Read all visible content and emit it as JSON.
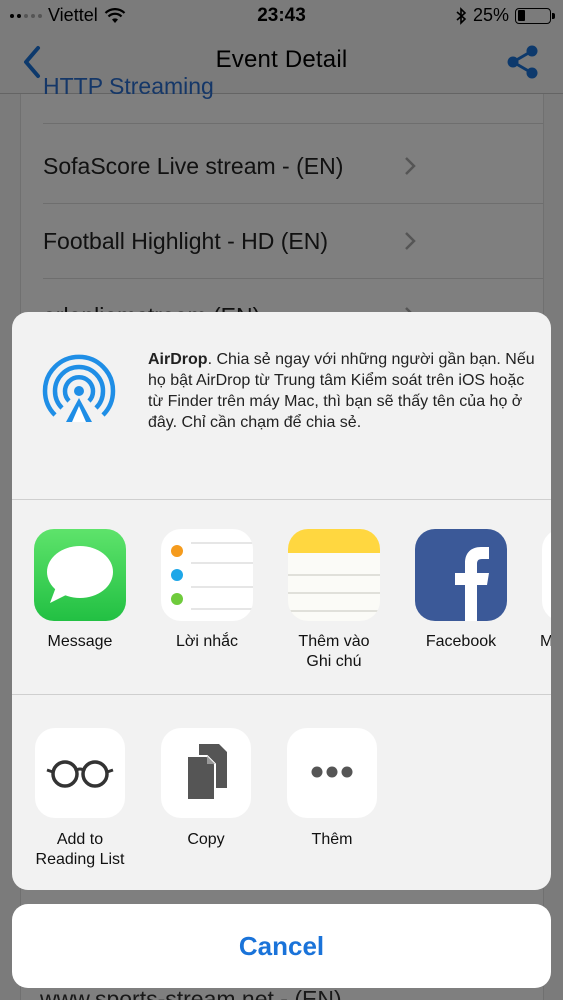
{
  "status_bar": {
    "carrier": "Viettel",
    "time": "23:43",
    "battery": "25%",
    "battery_level": 0.25
  },
  "nav": {
    "title": "Event Detail",
    "back_icon": "chevron-left-icon",
    "share_icon": "share-icon"
  },
  "list": {
    "partial_top": "HTTP Streaming",
    "items": [
      {
        "label": "SofaScore Live stream -  (EN)"
      },
      {
        "label": "Football Highlight - HD (EN)"
      },
      {
        "label": "arlenliemstream (EN)"
      }
    ],
    "partial_bottom": "www.sports-stream.net -  (EN)"
  },
  "share_sheet": {
    "airdrop": {
      "title": "AirDrop",
      "text": ". Chia sẻ ngay với những người gần bạn. Nếu họ bật AirDrop từ Trung tâm Kiểm soát trên iOS hoặc từ Finder trên máy Mac, thì bạn sẽ thấy tên của họ ở đây. Chỉ cần chạm để chia sẻ."
    },
    "apps": [
      {
        "label": "Message",
        "icon": "messages-icon"
      },
      {
        "label": "Lời nhắc",
        "icon": "reminders-icon"
      },
      {
        "label": "Thêm vào\nGhi chú",
        "icon": "notes-icon"
      },
      {
        "label": "Facebook",
        "icon": "facebook-icon"
      },
      {
        "label": "M",
        "icon": "messenger-icon"
      }
    ],
    "actions": [
      {
        "label": "Add to\nReading List",
        "icon": "glasses-icon"
      },
      {
        "label": "Copy",
        "icon": "copy-icon"
      },
      {
        "label": "Thêm",
        "icon": "more-icon"
      }
    ],
    "cancel_label": "Cancel"
  },
  "colors": {
    "accent": "#1a73d9",
    "messages_green": "#35c94b",
    "facebook_blue": "#3b5998",
    "notes_yellow": "#ffd740"
  }
}
